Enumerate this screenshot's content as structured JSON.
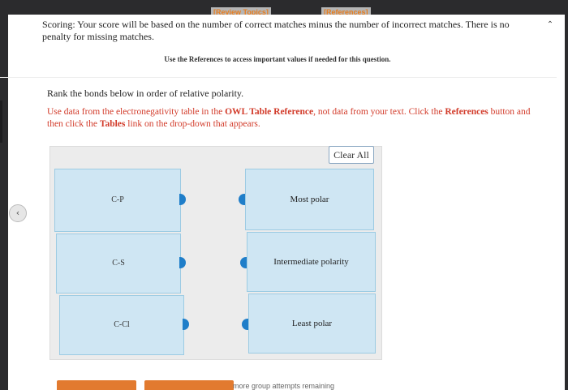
{
  "header": {
    "review_topics": "[Review Topics]",
    "references": "[References]"
  },
  "scoring_text": "Scoring: Your score will be based on the number of correct matches minus the number of incorrect matches. There is no penalty for missing matches.",
  "use_references_text": "Use the References to access important values if needed for this question.",
  "question": {
    "prompt": "Rank the bonds below in order of relative polarity.",
    "note_part1": "Use data from the electronegativity table in the ",
    "note_bold1": "OWL Table Reference",
    "note_part2": ", not data from your text. Click the ",
    "note_bold2": "References",
    "note_part3": " button and then click the ",
    "note_bold3": "Tables",
    "note_part4": " link on the drop-down that appears."
  },
  "clear_all_label": "Clear All",
  "items": [
    {
      "label": "C-P"
    },
    {
      "label": "C-S"
    },
    {
      "label": "C-Cl"
    }
  ],
  "slots": [
    {
      "label": "Most polar"
    },
    {
      "label": "Intermediate polarity"
    },
    {
      "label": "Least polar"
    }
  ],
  "footer": {
    "attempts_text": "more group attempts remaining"
  },
  "colors": {
    "accent_blue": "#1f7ec9",
    "link_orange": "#e87d1e",
    "note_red": "#d23b2a",
    "item_fill": "#cfe6f3"
  }
}
